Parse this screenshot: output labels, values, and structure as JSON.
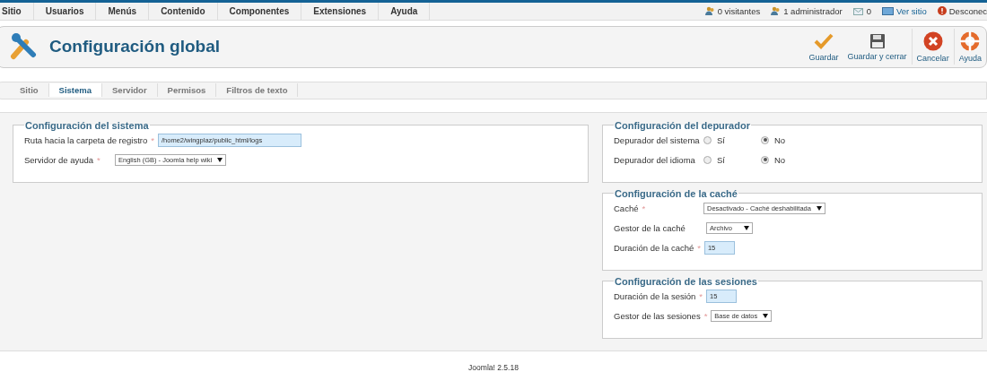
{
  "menu": {
    "items": [
      "Sitio",
      "Usuarios",
      "Menús",
      "Contenido",
      "Componentes",
      "Extensiones",
      "Ayuda"
    ],
    "status": [
      {
        "kind": "visitors",
        "label": "0 visitantes"
      },
      {
        "kind": "admins",
        "label": "1 administrador"
      },
      {
        "kind": "messages",
        "label": "0"
      },
      {
        "kind": "site",
        "label": "Ver sitio"
      },
      {
        "kind": "logout",
        "label": "Desconec"
      }
    ]
  },
  "header": {
    "title": "Configuración global",
    "toolbar": [
      {
        "kind": "save",
        "label": "Guardar"
      },
      {
        "kind": "save-close",
        "label": "Guardar y cerrar"
      },
      {
        "kind": "cancel",
        "label": "Cancelar"
      },
      {
        "kind": "help",
        "label": "Ayuda"
      }
    ]
  },
  "tabs": [
    {
      "label": "Sitio",
      "selected": false
    },
    {
      "label": "Sistema",
      "selected": true
    },
    {
      "label": "Servidor",
      "selected": false
    },
    {
      "label": "Permisos",
      "selected": false
    },
    {
      "label": "Filtros de texto",
      "selected": false
    }
  ],
  "columns": [
    [
      {
        "title": "Configuración del sistema",
        "fields": [
          {
            "kind": "text",
            "label": "Ruta hacia la carpeta de registro",
            "mark": "*",
            "value": "/home2/wingplaz/public_html/logs"
          },
          {
            "kind": "select",
            "label": "Servidor de ayuda",
            "mark": "*",
            "value": "English (GB) - Joomla help wiki"
          }
        ]
      }
    ],
    [
      {
        "title": "Configuración del depurador",
        "fields": [
          {
            "kind": "radio",
            "label": "Depurador del sistema",
            "options": [
              {
                "label": "Sí",
                "selected": false
              },
              {
                "label": "No",
                "selected": true
              }
            ]
          },
          {
            "kind": "radio",
            "label": "Depurador del idioma",
            "options": [
              {
                "label": "Sí",
                "selected": false
              },
              {
                "label": "No",
                "selected": true
              }
            ]
          }
        ]
      },
      {
        "title": "Configuración de la caché",
        "fields": [
          {
            "kind": "select",
            "label": "Caché",
            "mark": "*",
            "value": "Desactivado - Caché deshabilitada"
          },
          {
            "kind": "select",
            "label": "Gestor de la caché",
            "value": "Archivo"
          },
          {
            "kind": "text",
            "label": "Duración de la caché",
            "mark": "*",
            "value": "15"
          }
        ]
      },
      {
        "title": "Configuración de las sesiones",
        "fields": [
          {
            "kind": "text",
            "label": "Duración de la sesión",
            "mark": "*",
            "value": "15"
          },
          {
            "kind": "select",
            "label": "Gestor de las sesiones",
            "mark": "*",
            "value": "Base de datos"
          }
        ]
      }
    ]
  ],
  "footer": "Joomla! 2.5.18"
}
